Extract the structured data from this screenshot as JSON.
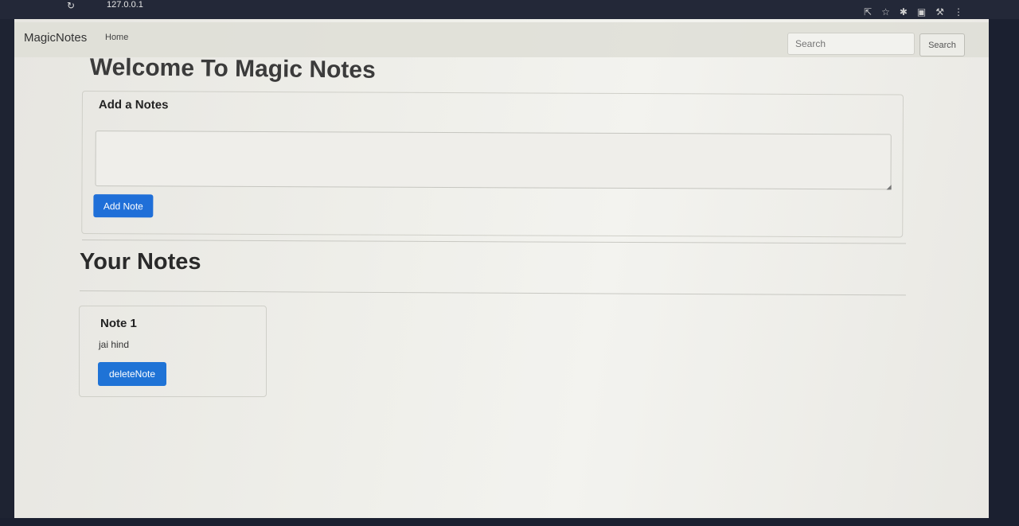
{
  "browser": {
    "address": "127.0.0.1",
    "toolbar_icons": [
      "share-icon",
      "star-icon",
      "extensions-icon",
      "sidebar-icon",
      "profile-icon",
      "menu-icon"
    ]
  },
  "navbar": {
    "brand": "MagicNotes",
    "home_link": "Home",
    "search_placeholder": "Search",
    "search_button": "Search"
  },
  "main": {
    "welcome_heading": "Welcome To Magic Notes",
    "add_card": {
      "title": "Add a Notes",
      "textarea_value": "",
      "add_button": "Add Note"
    },
    "notes_heading": "Your Notes",
    "notes": [
      {
        "title": "Note 1",
        "text": "jai hind",
        "delete_button": "deleteNote"
      }
    ]
  },
  "colors": {
    "primary_button": "#1f6fd8",
    "page_background": "#efefea",
    "browser_chrome": "#232838"
  }
}
